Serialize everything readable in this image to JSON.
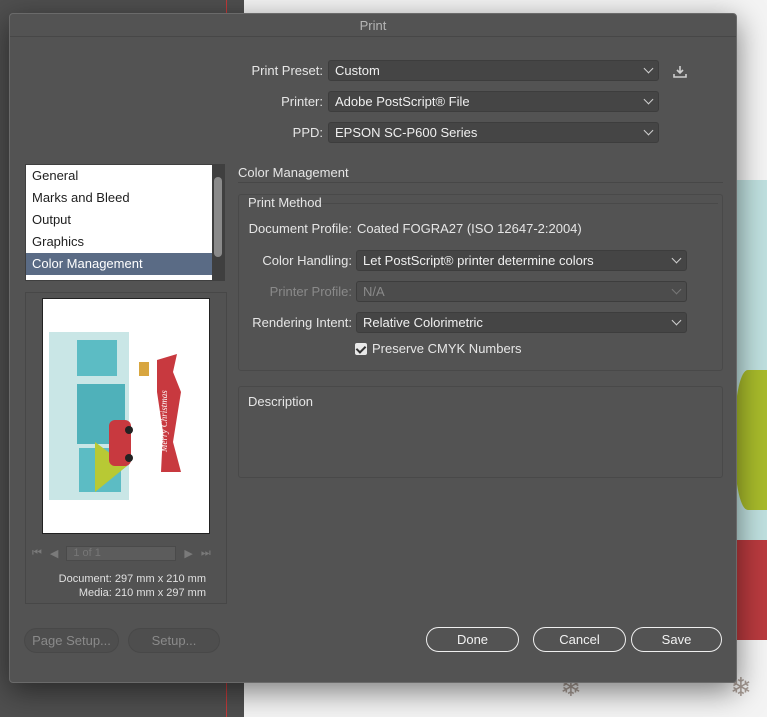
{
  "dialog": {
    "title": "Print"
  },
  "preset": {
    "label": "Print Preset:",
    "value": "Custom"
  },
  "printer": {
    "label": "Printer:",
    "value": "Adobe PostScript® File"
  },
  "ppd": {
    "label": "PPD:",
    "value": "EPSON SC-P600 Series"
  },
  "sidebar": {
    "items": [
      {
        "label": "General"
      },
      {
        "label": "Marks and Bleed"
      },
      {
        "label": "Output"
      },
      {
        "label": "Graphics"
      },
      {
        "label": "Color Management"
      }
    ]
  },
  "preview": {
    "page_field": "1 of 1",
    "document_dims": "Document: 297 mm x 210 mm",
    "media_dims": "Media: 210 mm x 297 mm",
    "art_text": "Merry Christmas"
  },
  "panel": {
    "title": "Color Management",
    "print_method": "Print Method",
    "document_profile_label": "Document Profile:",
    "document_profile_value": "Coated FOGRA27 (ISO 12647-2:2004)",
    "color_handling_label": "Color Handling:",
    "color_handling_value": "Let PostScript® printer determine colors",
    "printer_profile_label": "Printer Profile:",
    "printer_profile_value": "N/A",
    "rendering_intent_label": "Rendering Intent:",
    "rendering_intent_value": "Relative Colorimetric",
    "preserve_cmyk_label": "Preserve CMYK Numbers",
    "description_label": "Description"
  },
  "buttons": {
    "page_setup": "Page Setup...",
    "setup": "Setup...",
    "done": "Done",
    "cancel": "Cancel",
    "save": "Save"
  }
}
